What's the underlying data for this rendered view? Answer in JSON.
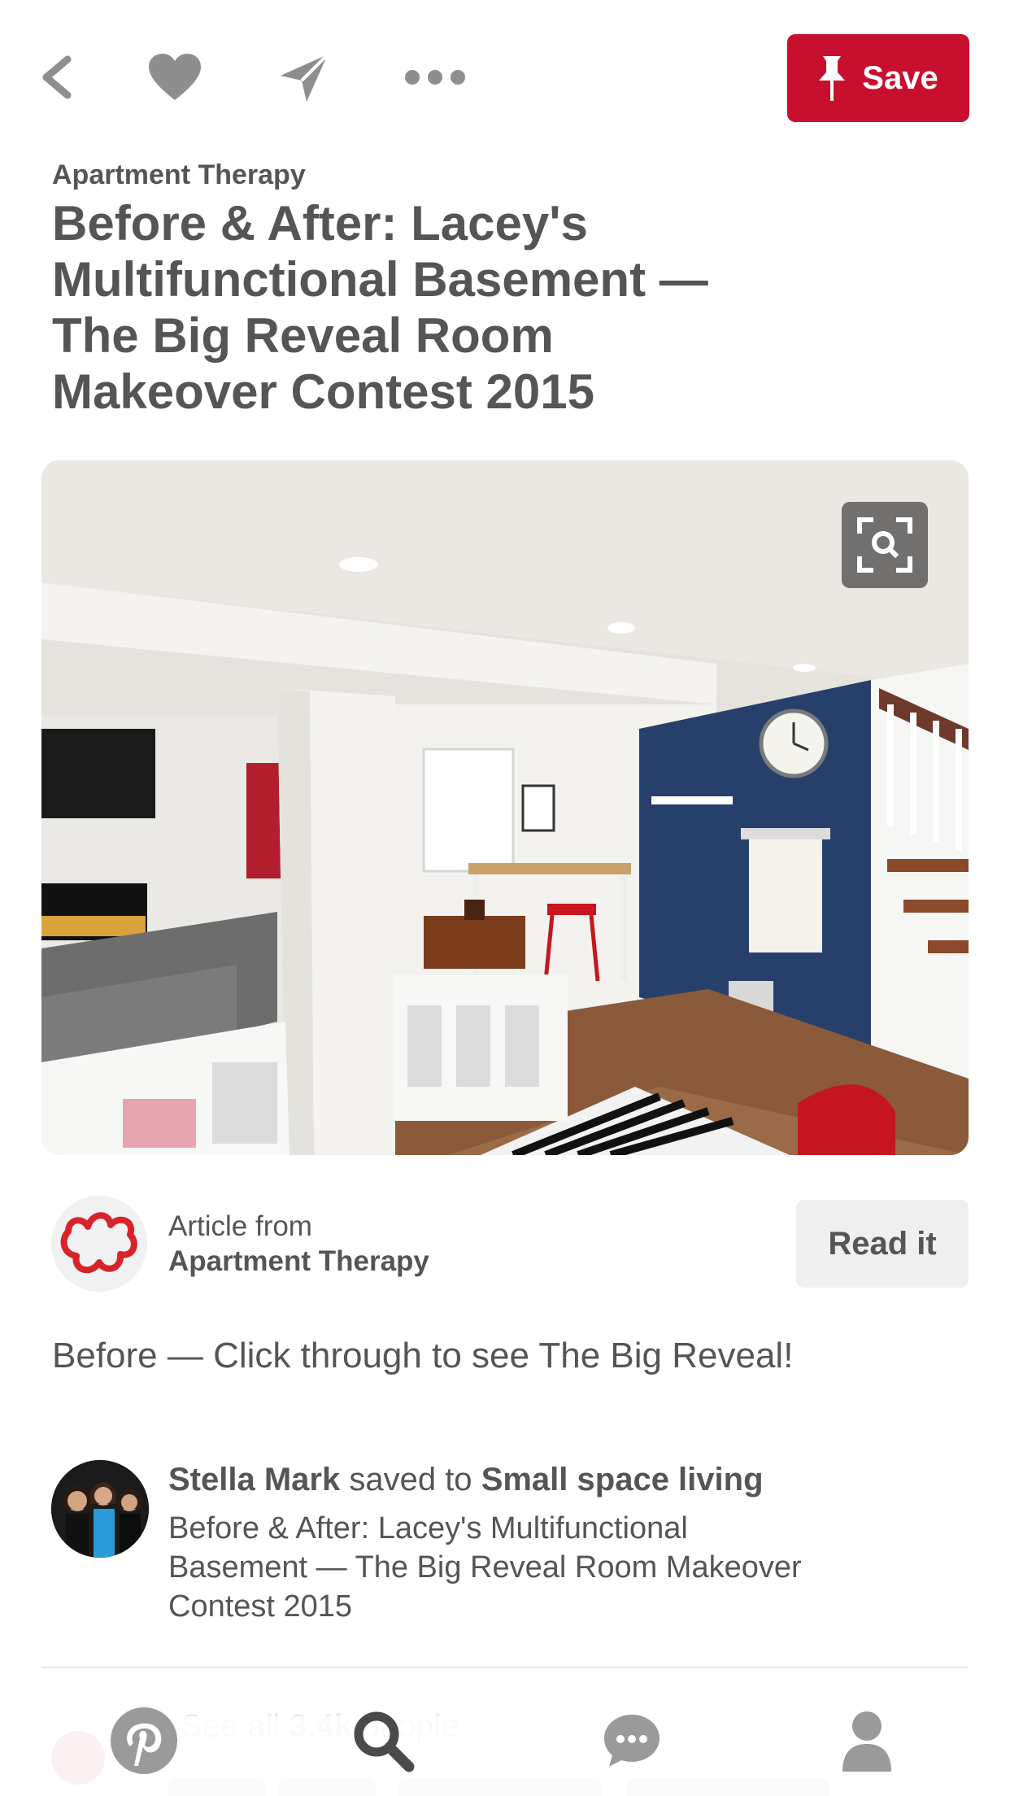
{
  "toolbar": {
    "back_icon": "back-arrow-icon",
    "like_icon": "heart-icon",
    "send_icon": "send-icon",
    "more_icon": "more-icon",
    "save_label": "Save",
    "save_color": "#c8102e"
  },
  "pin": {
    "source": "Apartment Therapy",
    "title": "Before & After: Lacey's Multifunctional Basement — The Big Reveal Room Makeover Contest 2015",
    "visual_search_icon": "visual-search-icon"
  },
  "article": {
    "from_label": "Article from",
    "source_name": "Apartment Therapy",
    "read_label": "Read it"
  },
  "description": "Before — Click through to see The Big Reveal!",
  "saved": {
    "user": "Stella Mark",
    "connector": "saved to",
    "board": "Small space living",
    "text": "Before & After: Lacey's Multifunctional Basement — The Big Reveal Room Makeover Contest 2015"
  },
  "faded": {
    "see_all_prefix": "See all",
    "count": "3.4k",
    "suffix": "people"
  },
  "tabbar": {
    "home_icon": "pinterest-logo-icon",
    "search_icon": "search-icon",
    "messages_icon": "chat-bubble-icon",
    "profile_icon": "person-icon"
  }
}
